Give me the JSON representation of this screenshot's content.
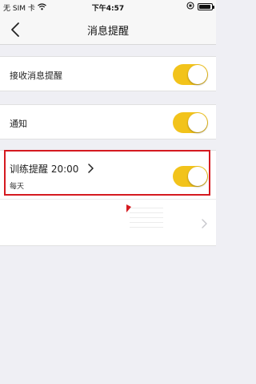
{
  "status_bar": {
    "carrier": "无 SIM 卡",
    "time": "下午4:57",
    "battery_level": 0.9
  },
  "nav": {
    "title": "消息提醒",
    "back_icon": "chevron-left-icon"
  },
  "settings": {
    "receive_messages": {
      "label": "接收消息提醒",
      "enabled": true
    },
    "notification": {
      "label": "通知",
      "enabled": true
    },
    "training_reminder": {
      "label": "训练提醒 20:00",
      "frequency": "每天",
      "enabled": true
    }
  },
  "colors": {
    "toggle_on": "#f2c31b",
    "highlight_frame": "#d51a20",
    "background": "#efeff4"
  }
}
